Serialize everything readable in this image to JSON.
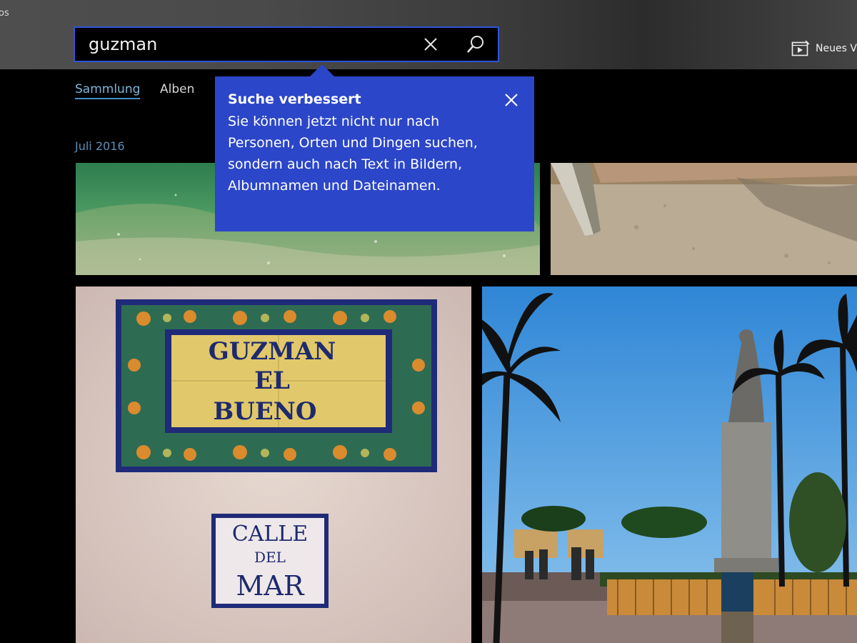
{
  "titlebar": {
    "app_name_fragment": "os"
  },
  "search": {
    "query": "guzman",
    "clear_icon": "close-icon",
    "submit_icon": "search-icon"
  },
  "toolbar": {
    "new_video_label": "Neues Vi",
    "new_video_icon": "video-editor-icon"
  },
  "tabs": [
    {
      "label": "Sammlung",
      "selected": true
    },
    {
      "label": "Alben",
      "selected": false
    }
  ],
  "section": {
    "date": "Juli 2016"
  },
  "teaching_tip": {
    "title": "Suche verbessert",
    "body": "Sie können jetzt nicht nur nach Personen, Orten und Dingen suchen, sondern auch nach Text in Bildern, Albumnamen und Dateinamen.",
    "close_icon": "close-icon"
  },
  "photo_text": {
    "tile_sign_line1": "GUZMAN",
    "tile_sign_line2": "EL",
    "tile_sign_line3": "BUENO",
    "street_sign_line1": "CALLE",
    "street_sign_line2": "DEL",
    "street_sign_line3": "MAR"
  },
  "colors": {
    "accent": "#2f54d8",
    "tip_background": "#2b46c9",
    "tab_selected": "#7fb6d9",
    "date_heading": "#5e8fb5"
  }
}
